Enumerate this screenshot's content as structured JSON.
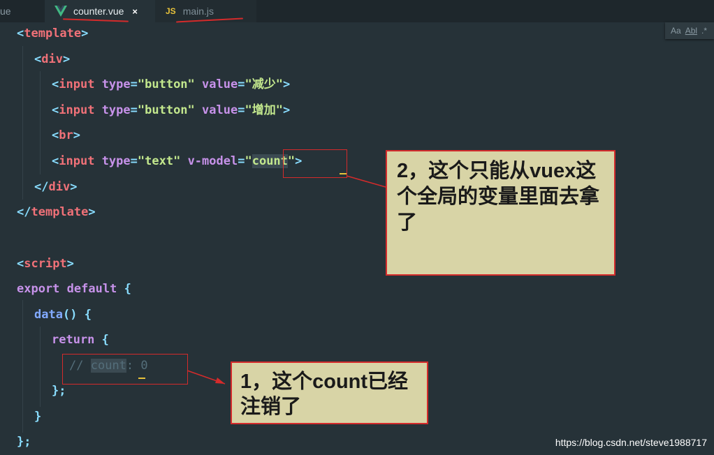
{
  "tabs": [
    {
      "label": "ue"
    },
    {
      "label": "counter.vue",
      "close": "×"
    },
    {
      "label": "main.js",
      "badge": "JS"
    }
  ],
  "find_widget": {
    "case": "Aa",
    "word": "Abl"
  },
  "code": {
    "l1": {
      "open": "<",
      "tag": "template",
      "close": ">"
    },
    "l2": {
      "open": "<",
      "tag": "div",
      "close": ">"
    },
    "l3": {
      "open": "<",
      "tag": "input",
      "a1": "type",
      "eq": "=",
      "v1": "\"button\"",
      "a2": "value",
      "v2": "\"减少\"",
      "close": ">"
    },
    "l4": {
      "open": "<",
      "tag": "input",
      "a1": "type",
      "eq": "=",
      "v1": "\"button\"",
      "a2": "value",
      "v2": "\"增加\"",
      "close": ">"
    },
    "l5": {
      "open": "<",
      "tag": "br",
      "close": ">"
    },
    "l6": {
      "open": "<",
      "tag": "input",
      "a1": "type",
      "eq": "=",
      "v1": "\"text\"",
      "a2": "v-model",
      "q": "\"",
      "v2": "count",
      "close": ">"
    },
    "l7": {
      "open": "</",
      "tag": "div",
      "close": ">"
    },
    "l8": {
      "open": "</",
      "tag": "template",
      "close": ">"
    },
    "l10": {
      "open": "<",
      "tag": "script",
      "close": ">"
    },
    "l11": {
      "k1": "export",
      "k2": "default",
      "brace": "{"
    },
    "l12": {
      "fn": "data",
      "parens": "()",
      "brace": "{"
    },
    "l13": {
      "kw": "return",
      "brace": "{"
    },
    "l14": {
      "slashes": "//",
      "key": "count",
      "rest": ": 0"
    },
    "l15": {
      "text": "};"
    },
    "l16": {
      "text": "}"
    },
    "l17": {
      "text": "};"
    }
  },
  "callouts": {
    "one": "1，这个count已经注销了",
    "two": "2，这个只能从vuex这个全局的变量里面去拿了"
  },
  "watermark": "https://blog.csdn.net/steve1988717",
  "colors": {
    "editor_bg": "#263238",
    "annotation_red": "#d42b2b",
    "callout_bg": "#d8d4a6"
  }
}
